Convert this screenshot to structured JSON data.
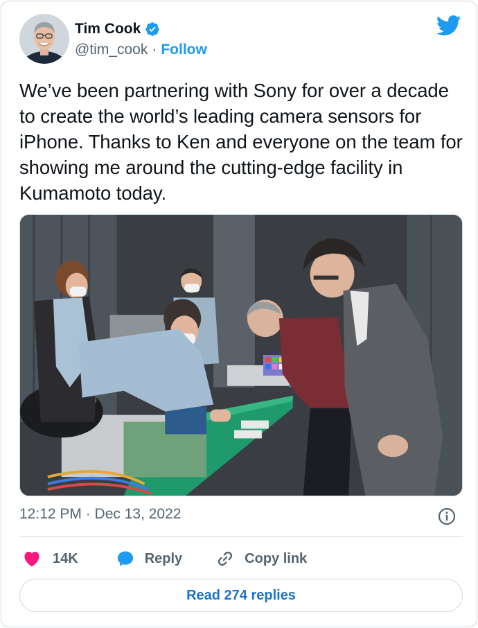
{
  "author": {
    "display_name": "Tim Cook",
    "handle": "@tim_cook",
    "separator": "·",
    "follow_label": "Follow",
    "verified": true
  },
  "tweet": {
    "text": "We’ve been partnering with Sony for over a decade to create the world’s leading camera sensors for iPhone. Thanks to Ken and everyone on the team for showing me around the cutting-edge facility in Kumamoto today.",
    "timestamp": "12:12 PM · Dec 13, 2022"
  },
  "actions": {
    "like_count": "14K",
    "reply_label": "Reply",
    "copy_link_label": "Copy link"
  },
  "read_replies_label": "Read 274 replies",
  "icons": {
    "brand": "twitter-bird-icon",
    "verified": "verified-badge-icon",
    "like": "heart-icon",
    "reply": "speech-bubble-icon",
    "copy": "link-icon",
    "info": "info-icon"
  },
  "colors": {
    "brand_blue": "#1d9bf0",
    "like_pink": "#f91880",
    "text_primary": "#0f1419",
    "text_secondary": "#536471",
    "border": "#cfd9de"
  }
}
